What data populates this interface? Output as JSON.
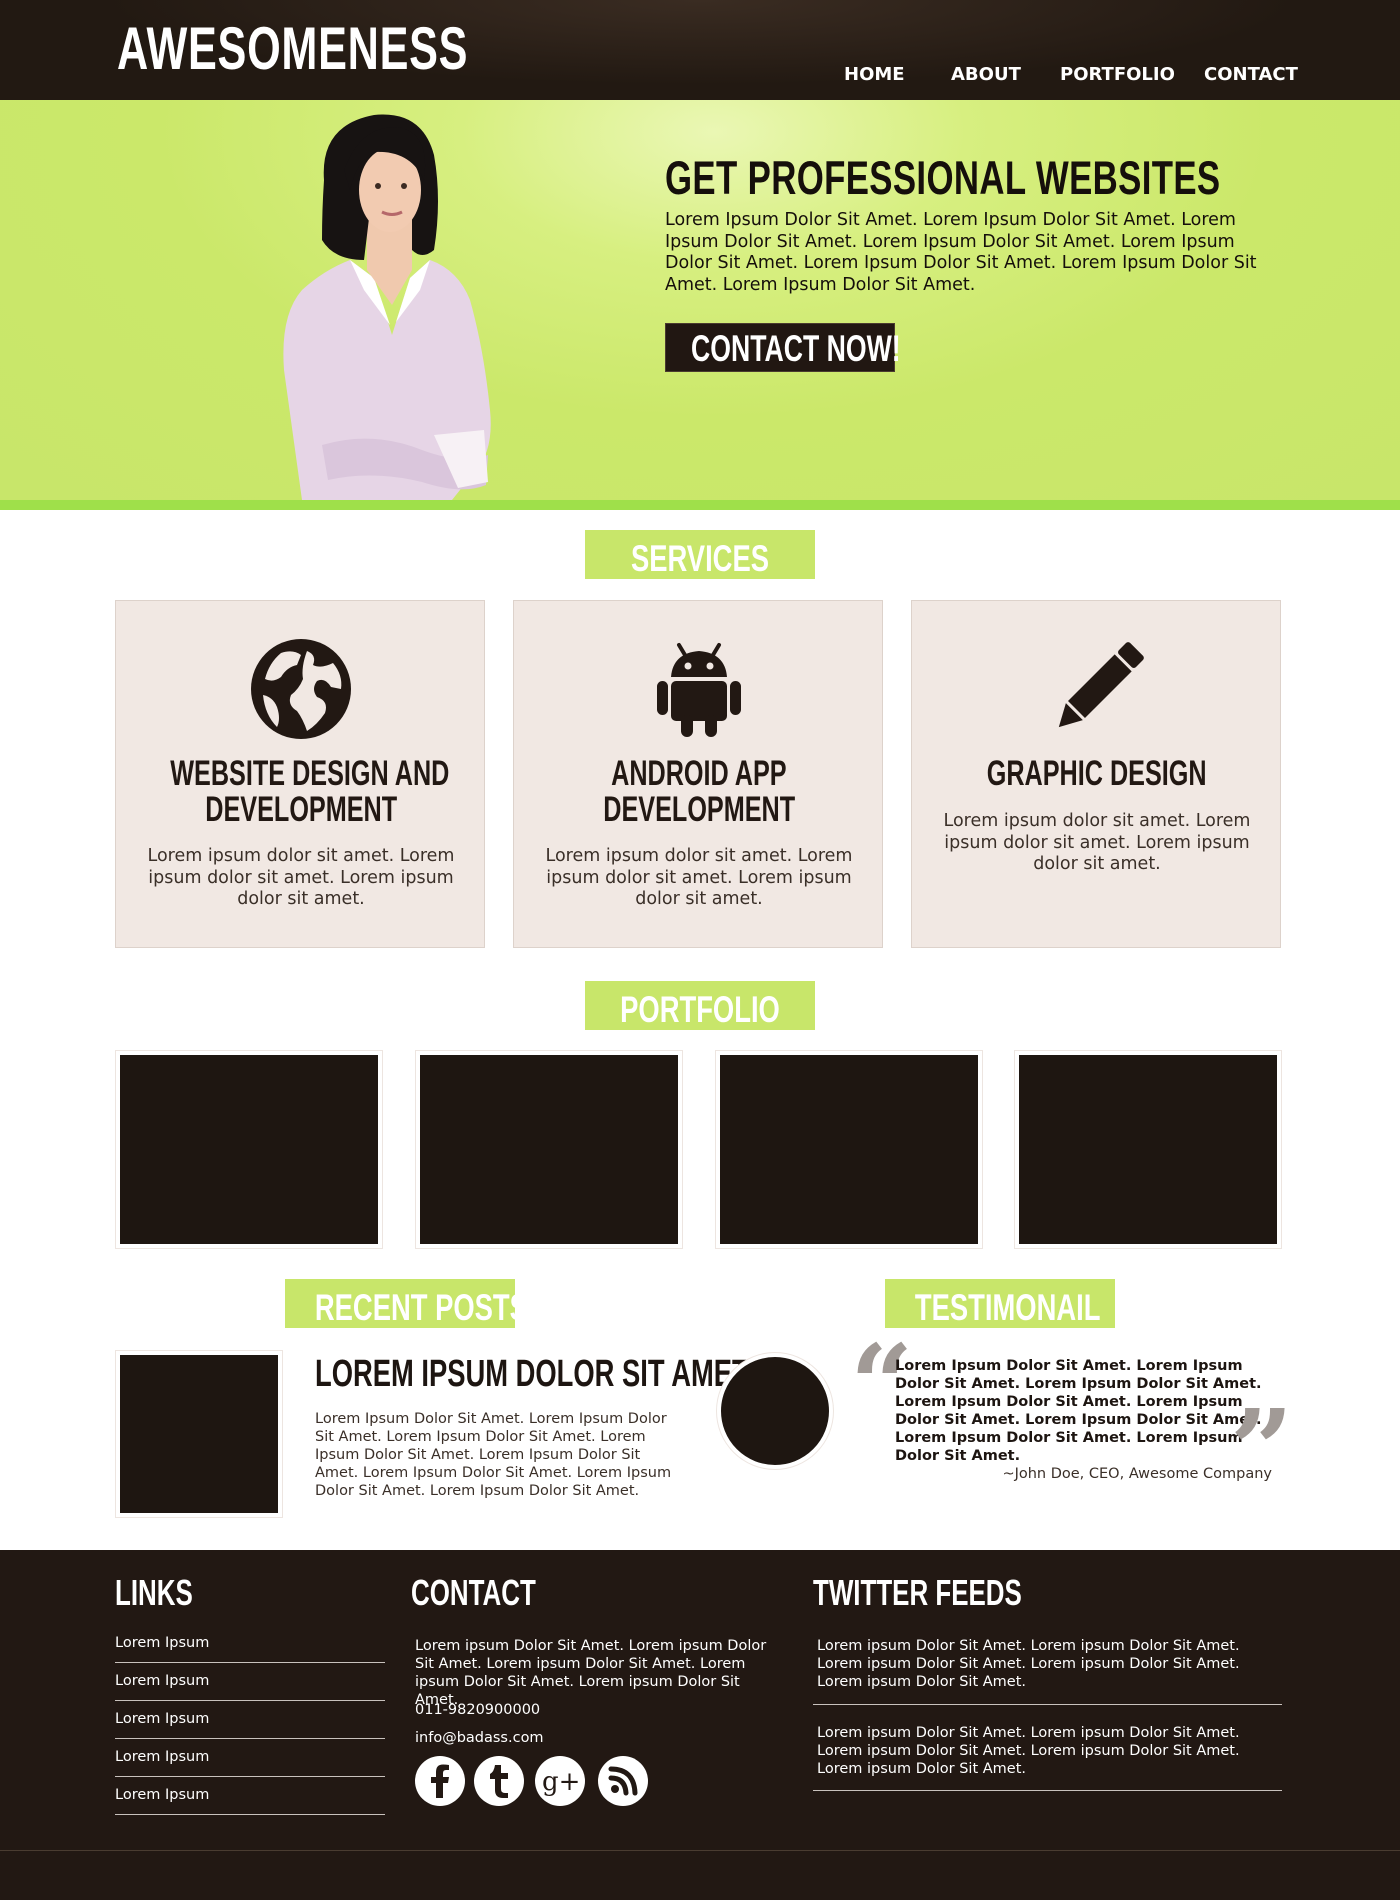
{
  "header": {
    "logo": "AWESOMENESS",
    "nav": [
      "HOME",
      "ABOUT",
      "PORTFOLIO",
      "CONTACT"
    ]
  },
  "hero": {
    "title": "GET PROFESSIONAL WEBSITES",
    "text": "Lorem Ipsum Dolor Sit Amet. Lorem Ipsum Dolor Sit Amet. Lorem Ipsum Dolor Sit Amet. Lorem Ipsum Dolor Sit Amet. Lorem Ipsum Dolor Sit Amet. Lorem Ipsum Dolor Sit Amet. Lorem Ipsum Dolor Sit Amet. Lorem Ipsum Dolor Sit Amet.",
    "button": "CONTACT NOW!"
  },
  "services": {
    "heading": "SERVICES",
    "items": [
      {
        "icon": "globe-icon",
        "title_line1": "WEBSITE DESIGN AND",
        "title_line2": "DEVELOPMENT",
        "text": "Lorem ipsum dolor sit amet. Lorem ipsum dolor sit amet. Lorem ipsum dolor sit amet."
      },
      {
        "icon": "android-icon",
        "title_line1": "ANDROID APP",
        "title_line2": "DEVELOPMENT",
        "text": "Lorem ipsum dolor sit amet. Lorem ipsum dolor sit amet. Lorem ipsum dolor sit amet."
      },
      {
        "icon": "pencil-icon",
        "title_line1": "GRAPHIC DESIGN",
        "title_line2": "",
        "text": "Lorem ipsum dolor sit amet. Lorem ipsum dolor sit amet. Lorem ipsum dolor sit amet."
      }
    ]
  },
  "portfolio": {
    "heading": "PORTFOLIO"
  },
  "recent_posts": {
    "heading": "RECENT POSTS",
    "title": "LOREM IPSUM DOLOR SIT AMET",
    "text": "Lorem Ipsum Dolor Sit Amet. Lorem Ipsum Dolor Sit Amet. Lorem Ipsum Dolor Sit Amet. Lorem Ipsum Dolor Sit Amet. Lorem Ipsum Dolor Sit Amet. Lorem Ipsum Dolor Sit Amet. Lorem Ipsum Dolor Sit Amet. Lorem Ipsum Dolor Sit Amet."
  },
  "testimonial": {
    "heading": "TESTIMONAIL",
    "text": "Lorem Ipsum Dolor Sit Amet. Lorem Ipsum Dolor Sit Amet. Lorem Ipsum Dolor Sit Amet. Lorem Ipsum Dolor Sit Amet. Lorem Ipsum Dolor Sit Amet. Lorem Ipsum Dolor Sit Amet. Lorem Ipsum Dolor Sit Amet. Lorem Ipsum Dolor Sit Amet.",
    "author": "~John Doe, CEO, Awesome Company"
  },
  "footer": {
    "links_heading": "LINKS",
    "links": [
      "Lorem Ipsum",
      "Lorem Ipsum",
      "Lorem Ipsum",
      "Lorem Ipsum",
      "Lorem Ipsum"
    ],
    "contact_heading": "CONTACT",
    "contact_text": "Lorem ipsum Dolor Sit Amet. Lorem ipsum Dolor Sit Amet. Lorem ipsum Dolor Sit Amet. Lorem ipsum Dolor Sit Amet. Lorem ipsum Dolor Sit Amet.",
    "phone": "011-9820900000",
    "email": "info@badass.com",
    "social": [
      "facebook-icon",
      "tumblr-icon",
      "google-plus-icon",
      "rss-icon"
    ],
    "twitter_heading": "TWITTER FEEDS",
    "tweets": [
      "Lorem ipsum Dolor Sit Amet. Lorem ipsum Dolor Sit Amet. Lorem ipsum Dolor Sit Amet. Lorem ipsum Dolor Sit Amet. Lorem ipsum Dolor Sit Amet.",
      "Lorem ipsum Dolor Sit Amet. Lorem ipsum Dolor Sit Amet. Lorem ipsum Dolor Sit Amet. Lorem ipsum Dolor Sit Amet. Lorem ipsum Dolor Sit Amet."
    ]
  },
  "colors": {
    "accent_green": "#c8e66a",
    "dark_brown": "#221813",
    "card_bg": "#f1e8e3"
  }
}
